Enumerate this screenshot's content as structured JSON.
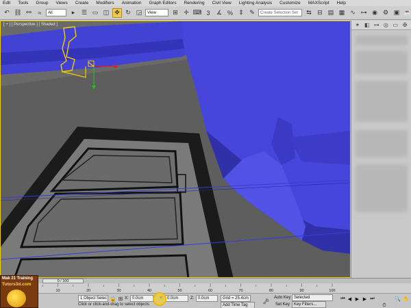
{
  "menu": [
    "Edit",
    "Tools",
    "Group",
    "Views",
    "Create",
    "Modifiers",
    "Animation",
    "Graph Editors",
    "Rendering",
    "Civil View",
    "Lighting Analysis",
    "Customize",
    "MAXScript",
    "Help"
  ],
  "toolbar": {
    "filter_value": "All",
    "ref_coord_value": "View",
    "selection_set_placeholder": "Create Selection Set"
  },
  "viewport": {
    "label": "[ + ] [ Perspective ] [ Shaded ]",
    "active_border_color": "#f0d000",
    "object_color": "#4a4ad6",
    "background_color": "#6a6a6a"
  },
  "timeline": {
    "frame_counter": "0 / 100",
    "ticks": [
      "0",
      "10",
      "20",
      "30",
      "40",
      "50",
      "60",
      "70",
      "80",
      "90",
      "100"
    ]
  },
  "logo": {
    "line1": "Mak 21 Training",
    "line2": "Tutors3d.com"
  },
  "status": {
    "selection": "1 Object Selec",
    "x_label": "X:",
    "x_value": "0.0cm",
    "y_label": "Y:",
    "y_value": "0.0cm",
    "z_label": "Z:",
    "z_value": "0.0cm",
    "grid": "Grid = 25.4cm",
    "autokey": "Auto Key",
    "autokey_value": "Selected",
    "setkey": "Set Key",
    "keyfilters": "Key Filters...",
    "add_time_tag": "Add Time Tag",
    "prompt": "Click or click-and-drag to select objects"
  },
  "colors": {
    "accent": "#f2c94c",
    "selected_yellow": "#f0d000"
  }
}
